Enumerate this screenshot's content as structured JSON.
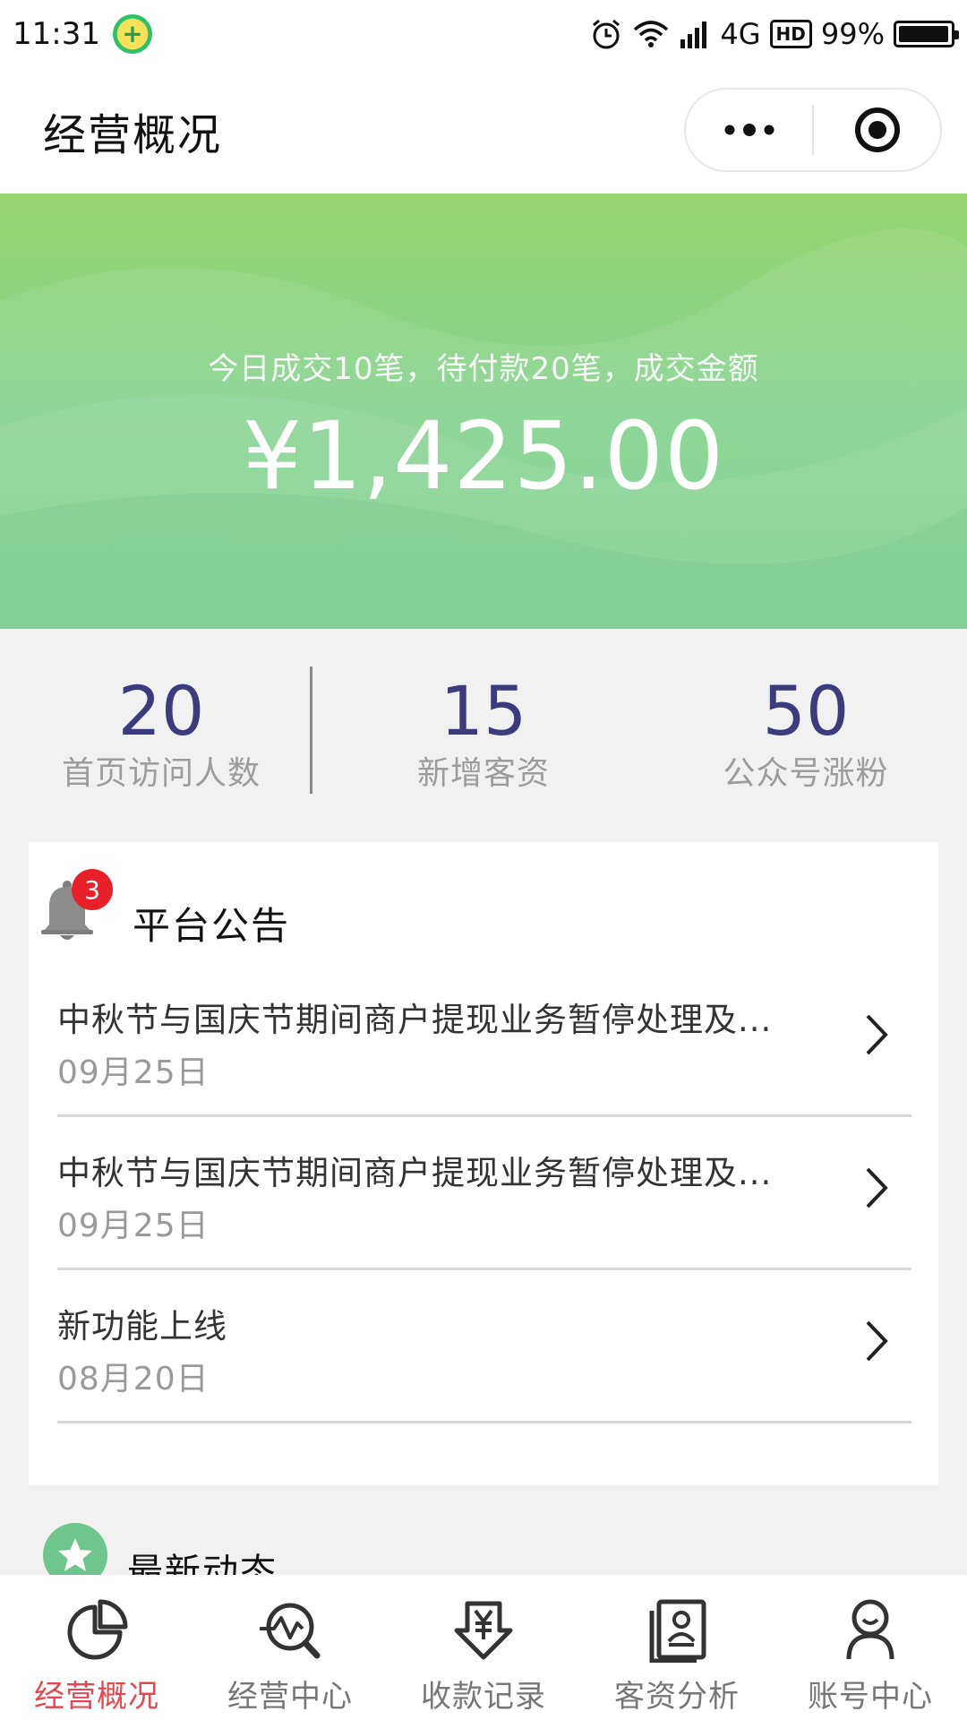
{
  "status_bar": {
    "time": "11:31",
    "network": "4G",
    "hd": "HD",
    "battery": "99%",
    "battery_level": 0.99
  },
  "nav": {
    "title": "经营概况"
  },
  "hero": {
    "summary": "今日成交10笔，待付款20笔，成交金额",
    "amount": "¥1,425.00"
  },
  "stats": [
    {
      "value": "20",
      "label": "首页访问人数"
    },
    {
      "value": "15",
      "label": "新增客资"
    },
    {
      "value": "50",
      "label": "公众号涨粉"
    }
  ],
  "notices": {
    "title": "平台公告",
    "badge": "3",
    "items": [
      {
        "title": "中秋节与国庆节期间商户提现业务暂停处理及...",
        "date": "09月25日"
      },
      {
        "title": "中秋节与国庆节期间商户提现业务暂停处理及...",
        "date": "09月25日"
      },
      {
        "title": "新功能上线",
        "date": "08月20日"
      }
    ]
  },
  "news": {
    "title": "最新动态"
  },
  "tabs": [
    {
      "label": "经营概况",
      "icon": "pie-chart-icon",
      "active": true
    },
    {
      "label": "经营中心",
      "icon": "analytics-search-icon",
      "active": false
    },
    {
      "label": "收款记录",
      "icon": "yen-download-icon",
      "active": false
    },
    {
      "label": "客资分析",
      "icon": "contact-book-icon",
      "active": false
    },
    {
      "label": "账号中心",
      "icon": "user-icon",
      "active": false
    }
  ],
  "colors": {
    "accent": "#e8464e",
    "hero_top": "#96d670",
    "hero_bottom": "#77cd8f",
    "stat_value": "#3b3b7e",
    "badge": "#e8202a"
  }
}
